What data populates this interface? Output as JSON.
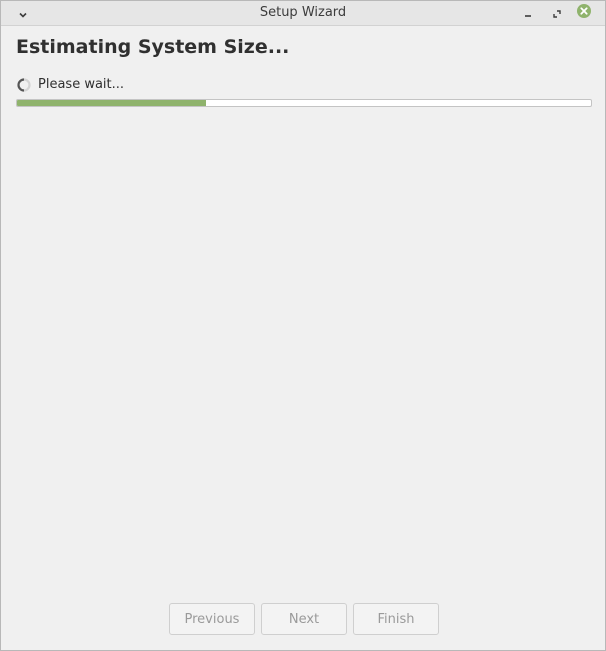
{
  "window": {
    "title": "Setup Wizard"
  },
  "titlebar": {
    "icons": [
      "chevron-down-icon",
      "minimize-icon",
      "maximize-icon",
      "close-icon"
    ],
    "close_color": "#8fb36c"
  },
  "main": {
    "heading": "Estimating System Size...",
    "status_text": "Please wait...",
    "progress_fraction": 0.33,
    "progress_color": "#8fb36c"
  },
  "footer": {
    "previous_label": "Previous",
    "next_label": "Next",
    "finish_label": "Finish"
  }
}
